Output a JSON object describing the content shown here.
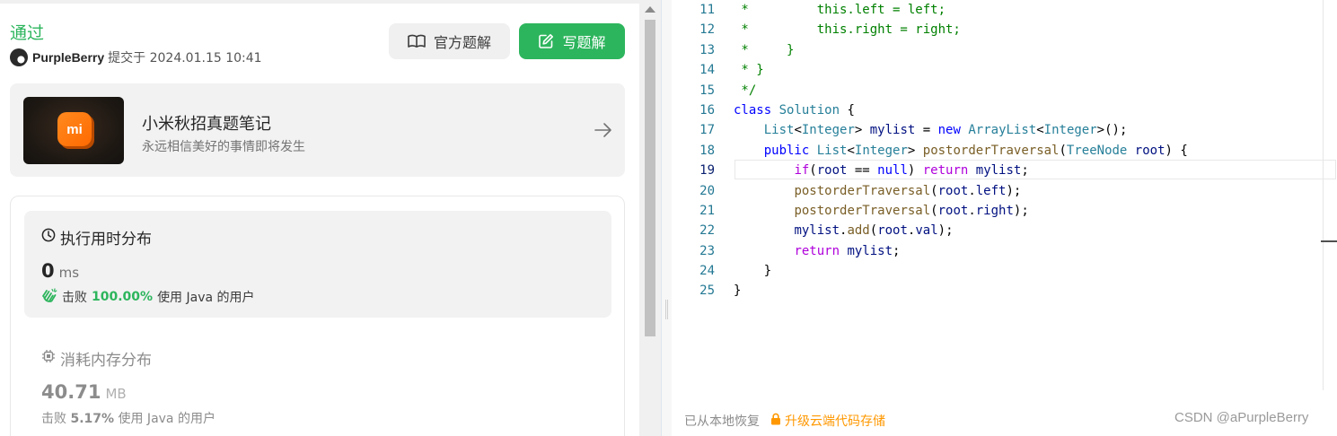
{
  "submission": {
    "status": "通过",
    "user": "PurpleBerry",
    "submitted_text": "提交于 2024.01.15 10:41"
  },
  "buttons": {
    "official": "官方题解",
    "write": "写题解"
  },
  "promo": {
    "title": "小米秋招真题笔记",
    "subtitle": "永远相信美好的事情即将发生",
    "logo_text": "mi"
  },
  "runtime": {
    "title": "执行用时分布",
    "value": "0",
    "unit": "ms",
    "beat_label": "击败",
    "beat_pct": "100.00%",
    "beat_suffix": "使用 Java 的用户"
  },
  "memory": {
    "title": "消耗内存分布",
    "value": "40.71",
    "unit": "MB",
    "beat_label": "击败",
    "beat_pct": "5.17%",
    "beat_suffix": "使用 Java 的用户"
  },
  "editor": {
    "active_line": 19,
    "line_numbers": [
      "11",
      "12",
      "13",
      "14",
      "15",
      "16",
      "17",
      "18",
      "19",
      "20",
      "21",
      "22",
      "23",
      "24",
      "25"
    ],
    "footer_restore": "已从本地恢复",
    "footer_upgrade": "升级云端代码存储",
    "lines": [
      [
        {
          "t": " *         this.left = left;",
          "c": "cm"
        }
      ],
      [
        {
          "t": " *         this.right = right;",
          "c": "cm"
        }
      ],
      [
        {
          "t": " *     }",
          "c": "cm"
        }
      ],
      [
        {
          "t": " * }",
          "c": "cm"
        }
      ],
      [
        {
          "t": " */",
          "c": "cm"
        }
      ],
      [
        {
          "t": "class",
          "c": "kw"
        },
        {
          "t": " "
        },
        {
          "t": "Solution",
          "c": "ty"
        },
        {
          "t": " {"
        }
      ],
      [
        {
          "t": "    "
        },
        {
          "t": "List",
          "c": "ty"
        },
        {
          "t": "<"
        },
        {
          "t": "Integer",
          "c": "ty"
        },
        {
          "t": "> "
        },
        {
          "t": "mylist",
          "c": "vr"
        },
        {
          "t": " = "
        },
        {
          "t": "new",
          "c": "kw"
        },
        {
          "t": " "
        },
        {
          "t": "ArrayList",
          "c": "ty"
        },
        {
          "t": "<"
        },
        {
          "t": "Integer",
          "c": "ty"
        },
        {
          "t": ">();"
        }
      ],
      [
        {
          "t": "    "
        },
        {
          "t": "public",
          "c": "kw"
        },
        {
          "t": " "
        },
        {
          "t": "List",
          "c": "ty"
        },
        {
          "t": "<"
        },
        {
          "t": "Integer",
          "c": "ty"
        },
        {
          "t": "> "
        },
        {
          "t": "postorderTraversal",
          "c": "fn"
        },
        {
          "t": "("
        },
        {
          "t": "TreeNode",
          "c": "ty"
        },
        {
          "t": " "
        },
        {
          "t": "root",
          "c": "vr"
        },
        {
          "t": ") {"
        }
      ],
      [
        {
          "t": "        "
        },
        {
          "t": "if",
          "c": "kw2"
        },
        {
          "t": "("
        },
        {
          "t": "root",
          "c": "vr"
        },
        {
          "t": " == "
        },
        {
          "t": "null",
          "c": "kw"
        },
        {
          "t": ") "
        },
        {
          "t": "return",
          "c": "kw2"
        },
        {
          "t": " "
        },
        {
          "t": "mylist",
          "c": "vr"
        },
        {
          "t": ";"
        }
      ],
      [
        {
          "t": "        "
        },
        {
          "t": "postorderTraversal",
          "c": "fn"
        },
        {
          "t": "("
        },
        {
          "t": "root",
          "c": "vr"
        },
        {
          "t": "."
        },
        {
          "t": "left",
          "c": "vr"
        },
        {
          "t": ");"
        }
      ],
      [
        {
          "t": "        "
        },
        {
          "t": "postorderTraversal",
          "c": "fn"
        },
        {
          "t": "("
        },
        {
          "t": "root",
          "c": "vr"
        },
        {
          "t": "."
        },
        {
          "t": "right",
          "c": "vr"
        },
        {
          "t": ");"
        }
      ],
      [
        {
          "t": "        "
        },
        {
          "t": "mylist",
          "c": "vr"
        },
        {
          "t": "."
        },
        {
          "t": "add",
          "c": "fn"
        },
        {
          "t": "("
        },
        {
          "t": "root",
          "c": "vr"
        },
        {
          "t": "."
        },
        {
          "t": "val",
          "c": "vr"
        },
        {
          "t": ");"
        }
      ],
      [
        {
          "t": "        "
        },
        {
          "t": "return",
          "c": "kw2"
        },
        {
          "t": " "
        },
        {
          "t": "mylist",
          "c": "vr"
        },
        {
          "t": ";"
        }
      ],
      [
        {
          "t": "    }"
        }
      ],
      [
        {
          "t": "}"
        }
      ]
    ]
  },
  "watermark": "CSDN @aPurpleBerry",
  "icons": {
    "status_icon": "clock-icon",
    "memory_icon": "chip-icon",
    "beat_icon": "clap-hands-icon",
    "official_icon": "book-icon",
    "write_icon": "edit-icon",
    "upgrade_icon": "lock-icon",
    "promo_arrow": "arrow-right-icon"
  },
  "colors": {
    "accent_green": "#2db55d",
    "upgrade_orange": "#ff9800"
  }
}
